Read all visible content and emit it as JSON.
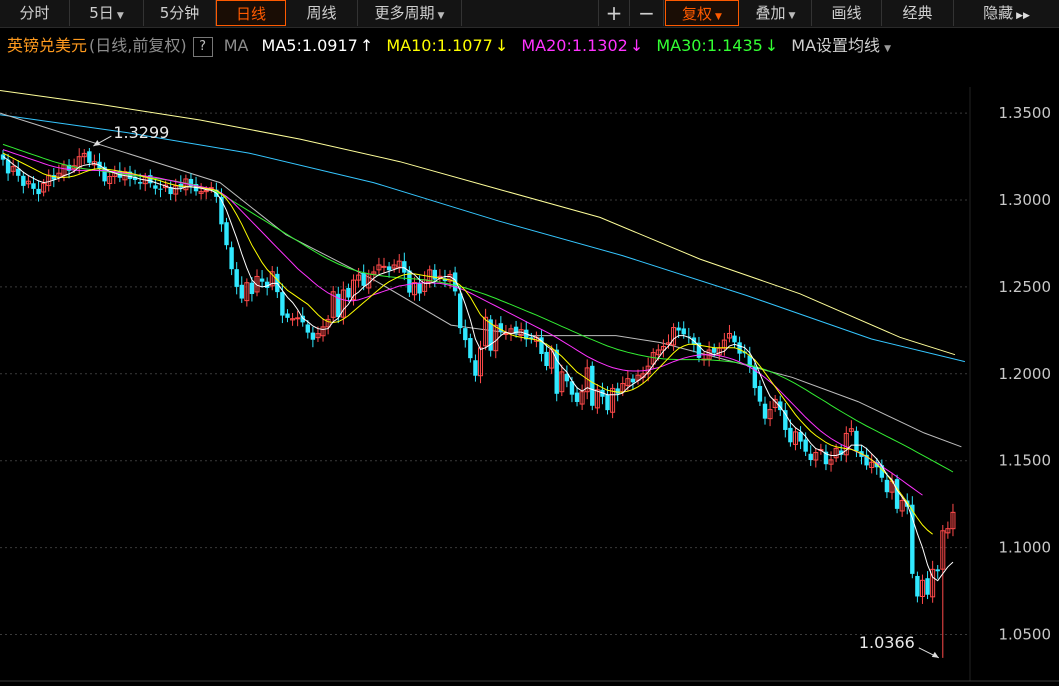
{
  "toolbar": {
    "tabs": [
      {
        "label": "分时",
        "arrow": ""
      },
      {
        "label": "5日",
        "arrow": "▼"
      },
      {
        "label": "5分钟",
        "arrow": ""
      },
      {
        "label": "日线",
        "arrow": ""
      },
      {
        "label": "周线",
        "arrow": ""
      },
      {
        "label": "更多周期",
        "arrow": "▼"
      }
    ],
    "active_tab": "日线",
    "zoom_in": "+",
    "zoom_out": "−",
    "right": [
      {
        "label": "复权",
        "arrow": "▼",
        "active": true
      },
      {
        "label": "叠加",
        "arrow": "▼",
        "active": false
      },
      {
        "label": "画线",
        "arrow": "",
        "active": false
      },
      {
        "label": "经典",
        "arrow": "",
        "active": false
      },
      {
        "label": "隐藏",
        "arrow": "▶▶",
        "active": false
      }
    ]
  },
  "legend": {
    "name": "英镑兑美元",
    "mode": "(日线,前复权)",
    "help": "?",
    "ma_label": "MA",
    "ma5": {
      "label": "MA5:1.0917",
      "arrow": "↑",
      "color": "#ffffff"
    },
    "ma10": {
      "label": "MA10:1.1077",
      "arrow": "↓",
      "color": "#ffff00"
    },
    "ma20": {
      "label": "MA20:1.1302",
      "arrow": "↓",
      "color": "#ff33ff"
    },
    "ma30": {
      "label": "MA30:1.1435",
      "arrow": "↓",
      "color": "#33ff33"
    },
    "ma_more": "MA",
    "settings": "设置均线",
    "settings_arrow": "▼"
  },
  "chart_data": {
    "type": "candlestick",
    "ylim": [
      1.025,
      1.365
    ],
    "y_ticks": [
      1.35,
      1.3,
      1.25,
      1.2,
      1.15,
      1.1,
      1.05
    ],
    "y_tick_labels": [
      "1.3500",
      "1.3000",
      "1.2500",
      "1.2000",
      "1.1500",
      "1.1000",
      "1.0500"
    ],
    "up_color": "#ff4a4a",
    "down_color": "#31e8ff",
    "annotations": [
      {
        "text": "1.3299",
        "value": 1.3299,
        "bar": 17
      },
      {
        "text": "1.0366",
        "value": 1.0366,
        "bar": 185
      }
    ],
    "closes": [
      1.3232,
      1.3153,
      1.3192,
      1.3139,
      1.3081,
      1.3108,
      1.3064,
      1.3034,
      1.3095,
      1.3143,
      1.3117,
      1.3154,
      1.3202,
      1.3168,
      1.3197,
      1.3249,
      1.3268,
      1.3214,
      1.322,
      1.3179,
      1.3107,
      1.3135,
      1.3156,
      1.3128,
      1.3163,
      1.3121,
      1.3115,
      1.3094,
      1.3131,
      1.3096,
      1.3065,
      1.3059,
      1.3086,
      1.3034,
      1.3081,
      1.3071,
      1.3121,
      1.308,
      1.305,
      1.3048,
      1.3055,
      1.3071,
      1.3018,
      1.286,
      1.274,
      1.2602,
      1.25,
      1.2433,
      1.2524,
      1.2459,
      1.256,
      1.253,
      1.2494,
      1.2587,
      1.247,
      1.2335,
      1.2322,
      1.2317,
      1.2322,
      1.2296,
      1.2237,
      1.2196,
      1.2231,
      1.227,
      1.2313,
      1.2472,
      1.2326,
      1.2482,
      1.2439,
      1.2539,
      1.2568,
      1.2506,
      1.2574,
      1.2586,
      1.2626,
      1.2618,
      1.2596,
      1.2626,
      1.2648,
      1.2582,
      1.2467,
      1.2525,
      1.2462,
      1.2541,
      1.2598,
      1.2542,
      1.2561,
      1.2533,
      1.2571,
      1.2474,
      1.2263,
      1.2194,
      1.209,
      1.1989,
      1.2149,
      1.2325,
      1.2133,
      1.2279,
      1.2242,
      1.2232,
      1.2259,
      1.2233,
      1.2254,
      1.2198,
      1.2199,
      1.221,
      1.2114,
      1.2045,
      1.2139,
      1.1885,
      1.2011,
      1.1957,
      1.188,
      1.1838,
      1.1897,
      1.2034,
      1.1816,
      1.1908,
      1.1868,
      1.1791,
      1.1916,
      1.1885,
      1.1944,
      1.1972,
      1.1951,
      1.1992,
      1.2,
      1.2044,
      1.2122,
      1.2137,
      1.2157,
      1.2178,
      1.2266,
      1.2249,
      1.2227,
      1.2209,
      1.2167,
      1.2092,
      1.2085,
      1.2137,
      1.2121,
      1.2147,
      1.2194,
      1.2232,
      1.2181,
      1.2116,
      1.2118,
      1.2039,
      1.1918,
      1.184,
      1.1742,
      1.1794,
      1.1853,
      1.1791,
      1.1677,
      1.1606,
      1.1666,
      1.161,
      1.1552,
      1.1504,
      1.1547,
      1.1564,
      1.148,
      1.1505,
      1.1571,
      1.1534,
      1.1657,
      1.1684,
      1.1555,
      1.1522,
      1.1473,
      1.1491,
      1.1462,
      1.1402,
      1.1319,
      1.1382,
      1.1223,
      1.1271,
      1.1235,
      1.0849,
      1.0719,
      1.0812,
      1.0729,
      1.0875,
      1.0864,
      1.1097,
      1.1109,
      1.1203
    ],
    "ma5": [
      1.325,
      1.323,
      1.3205,
      1.3185,
      1.316,
      1.314,
      1.3125,
      1.311,
      1.31,
      1.3105,
      1.3115,
      1.3125,
      1.314,
      1.315,
      1.3165,
      1.319,
      1.32,
      1.3205,
      1.321,
      1.32,
      1.318,
      1.3165,
      1.3155,
      1.3145,
      1.314,
      1.3135,
      1.313,
      1.312,
      1.3115,
      1.311,
      1.31,
      1.309,
      1.308,
      1.307,
      1.3065,
      1.3065,
      1.3075,
      1.3075,
      1.3072,
      1.3068,
      1.306,
      1.3055,
      1.304,
      1.3,
      1.294,
      1.286,
      1.278,
      1.269,
      1.261,
      1.254,
      1.251,
      1.25,
      1.2505,
      1.252,
      1.252,
      1.248,
      1.244,
      1.241,
      1.237,
      1.232,
      1.23,
      1.2275,
      1.226,
      1.2255,
      1.226,
      1.23,
      1.232,
      1.237,
      1.24,
      1.245,
      1.247,
      1.25,
      1.252,
      1.255,
      1.257,
      1.258,
      1.259,
      1.26,
      1.261,
      1.261,
      1.259,
      1.257,
      1.254,
      1.252,
      1.252,
      1.253,
      1.255,
      1.256,
      1.256,
      1.254,
      1.248,
      1.24,
      1.231,
      1.22,
      1.214,
      1.215,
      1.217,
      1.219,
      1.222,
      1.224,
      1.223,
      1.224,
      1.224,
      1.223,
      1.222,
      1.221,
      1.219,
      1.216,
      1.214,
      1.208,
      1.204,
      1.201,
      1.196,
      1.192,
      1.19,
      1.192,
      1.191,
      1.19,
      1.189,
      1.188,
      1.188,
      1.188,
      1.189,
      1.192,
      1.194,
      1.196,
      1.198,
      1.201,
      1.205,
      1.209,
      1.213,
      1.216,
      1.22,
      1.222,
      1.222,
      1.221,
      1.219,
      1.216,
      1.213,
      1.212,
      1.211,
      1.212,
      1.213,
      1.216,
      1.217,
      1.216,
      1.215,
      1.212,
      1.207,
      1.2,
      1.193,
      1.187,
      1.184,
      1.181,
      1.177,
      1.172,
      1.169,
      1.167,
      1.164,
      1.16,
      1.157,
      1.156,
      1.154,
      1.153,
      1.153,
      1.154,
      1.156,
      1.159,
      1.159,
      1.159,
      1.157,
      1.154,
      1.151,
      1.147,
      1.142,
      1.139,
      1.133,
      1.129,
      1.125,
      1.117,
      1.108,
      1.1,
      1.09,
      1.083,
      1.081,
      1.085,
      1.089,
      1.0917
    ],
    "ma10": [
      1.327,
      1.3255,
      1.324,
      1.3225,
      1.321,
      1.3195,
      1.318,
      1.3165,
      1.315,
      1.314,
      1.3135,
      1.313,
      1.313,
      1.3132,
      1.3138,
      1.3148,
      1.316,
      1.317,
      1.3178,
      1.318,
      1.3178,
      1.3175,
      1.317,
      1.3165,
      1.316,
      1.3155,
      1.3148,
      1.314,
      1.3132,
      1.3125,
      1.3118,
      1.311,
      1.31,
      1.3092,
      1.3085,
      1.308,
      1.3078,
      1.3076,
      1.3074,
      1.307,
      1.3066,
      1.3062,
      1.3055,
      1.3035,
      1.3005,
      1.2965,
      1.2915,
      1.286,
      1.28,
      1.274,
      1.269,
      1.264,
      1.26,
      1.257,
      1.254,
      1.251,
      1.248,
      1.246,
      1.244,
      1.242,
      1.24,
      1.237,
      1.234,
      1.2315,
      1.23,
      1.2295,
      1.23,
      1.2315,
      1.2335,
      1.236,
      1.2385,
      1.241,
      1.2435,
      1.246,
      1.2485,
      1.251,
      1.253,
      1.2545,
      1.256,
      1.257,
      1.2575,
      1.2575,
      1.257,
      1.2565,
      1.256,
      1.2555,
      1.255,
      1.2545,
      1.254,
      1.253,
      1.251,
      1.248,
      1.244,
      1.239,
      1.234,
      1.231,
      1.229,
      1.227,
      1.2255,
      1.224,
      1.2225,
      1.2215,
      1.221,
      1.2205,
      1.22,
      1.2195,
      1.2185,
      1.217,
      1.215,
      1.2125,
      1.21,
      1.207,
      1.204,
      1.201,
      1.199,
      1.197,
      1.195,
      1.1935,
      1.192,
      1.1905,
      1.19,
      1.1895,
      1.1895,
      1.19,
      1.191,
      1.1925,
      1.1945,
      1.197,
      1.2,
      1.203,
      1.206,
      1.209,
      1.212,
      1.2145,
      1.216,
      1.217,
      1.217,
      1.2165,
      1.216,
      1.2155,
      1.215,
      1.215,
      1.215,
      1.215,
      1.215,
      1.214,
      1.2125,
      1.2105,
      1.208,
      1.2045,
      1.2005,
      1.1965,
      1.1925,
      1.1885,
      1.1845,
      1.1805,
      1.1765,
      1.173,
      1.17,
      1.167,
      1.1645,
      1.1625,
      1.1605,
      1.159,
      1.158,
      1.1575,
      1.157,
      1.1565,
      1.1555,
      1.154,
      1.1525,
      1.1505,
      1.148,
      1.145,
      1.142,
      1.138,
      1.134,
      1.13,
      1.126,
      1.1215,
      1.117,
      1.113,
      1.11,
      1.1077
    ],
    "ma20": [
      1.329,
      1.328,
      1.327,
      1.326,
      1.325,
      1.324,
      1.323,
      1.322,
      1.321,
      1.32,
      1.3192,
      1.3185,
      1.318,
      1.3176,
      1.3172,
      1.317,
      1.317,
      1.317,
      1.317,
      1.317,
      1.3168,
      1.3165,
      1.3162,
      1.3158,
      1.3154,
      1.315,
      1.3146,
      1.3142,
      1.3138,
      1.3134,
      1.313,
      1.3124,
      1.3118,
      1.3112,
      1.3106,
      1.31,
      1.3094,
      1.3088,
      1.3082,
      1.3076,
      1.307,
      1.3064,
      1.3055,
      1.304,
      1.302,
      1.2995,
      1.2965,
      1.2935,
      1.2905,
      1.2875,
      1.2845,
      1.2815,
      1.2785,
      1.2755,
      1.2725,
      1.2695,
      1.2665,
      1.2635,
      1.2605,
      1.258,
      1.2555,
      1.253,
      1.2505,
      1.2485,
      1.2465,
      1.245,
      1.2435,
      1.2425,
      1.242,
      1.242,
      1.2425,
      1.2435,
      1.2445,
      1.2455,
      1.2465,
      1.2475,
      1.2485,
      1.2495,
      1.2505,
      1.251,
      1.2515,
      1.252,
      1.2522,
      1.2523,
      1.2523,
      1.2522,
      1.252,
      1.2515,
      1.2508,
      1.25,
      1.249,
      1.2478,
      1.2465,
      1.245,
      1.2435,
      1.242,
      1.2405,
      1.239,
      1.2375,
      1.236,
      1.2345,
      1.233,
      1.2315,
      1.23,
      1.2285,
      1.227,
      1.2255,
      1.224,
      1.2225,
      1.2208,
      1.219,
      1.2172,
      1.2154,
      1.2136,
      1.2118,
      1.21,
      1.2085,
      1.207,
      1.2058,
      1.2046,
      1.2036,
      1.2028,
      1.2022,
      1.2018,
      1.2016,
      1.2016,
      1.2018,
      1.2022,
      1.2028,
      1.2036,
      1.2046,
      1.2058,
      1.207,
      1.208,
      1.209,
      1.2098,
      1.2104,
      1.2108,
      1.211,
      1.211,
      1.2108,
      1.2104,
      1.2098,
      1.209,
      1.208,
      1.2068,
      1.2054,
      1.2038,
      1.202,
      1.2,
      1.1978,
      1.1954,
      1.1928,
      1.19,
      1.187,
      1.184,
      1.181,
      1.178,
      1.175,
      1.1722,
      1.1695,
      1.167,
      1.1648,
      1.1628,
      1.161,
      1.1594,
      1.158,
      1.1566,
      1.1552,
      1.1538,
      1.1522,
      1.1505,
      1.1487,
      1.1468,
      1.1448,
      1.1428,
      1.1407,
      1.1386,
      1.1365,
      1.1344,
      1.1323,
      1.1302
    ],
    "ma30": [
      1.332,
      1.331,
      1.33,
      1.329,
      1.328,
      1.327,
      1.326,
      1.325,
      1.324,
      1.323,
      1.322,
      1.3212,
      1.3204,
      1.3196,
      1.319,
      1.3184,
      1.318,
      1.3176,
      1.3172,
      1.3168,
      1.3164,
      1.316,
      1.3156,
      1.3152,
      1.3148,
      1.3144,
      1.314,
      1.3136,
      1.3132,
      1.3128,
      1.3124,
      1.312,
      1.3116,
      1.3112,
      1.3108,
      1.3102,
      1.3096,
      1.309,
      1.3084,
      1.3076,
      1.3068,
      1.3058,
      1.3046,
      1.3032,
      1.3016,
      1.2998,
      1.298,
      1.2962,
      1.2944,
      1.2926,
      1.2908,
      1.289,
      1.2872,
      1.2854,
      1.2836,
      1.2818,
      1.28,
      1.2782,
      1.2764,
      1.2746,
      1.2728,
      1.271,
      1.2692,
      1.2676,
      1.266,
      1.2646,
      1.2632,
      1.262,
      1.2608,
      1.2598,
      1.259,
      1.2582,
      1.2575,
      1.257,
      1.2566,
      1.2562,
      1.2558,
      1.2555,
      1.2552,
      1.255,
      1.2548,
      1.2546,
      1.2543,
      1.254,
      1.2536,
      1.2532,
      1.2527,
      1.2522,
      1.2516,
      1.251,
      1.2502,
      1.2494,
      1.2485,
      1.2476,
      1.2466,
      1.2456,
      1.2445,
      1.2434,
      1.2422,
      1.241,
      1.2398,
      1.2386,
      1.2374,
      1.2362,
      1.235,
      1.2338,
      1.2325,
      1.2312,
      1.2299,
      1.2286,
      1.2273,
      1.226,
      1.2247,
      1.2234,
      1.2221,
      1.2208,
      1.2196,
      1.2184,
      1.2172,
      1.216,
      1.215,
      1.214,
      1.2132,
      1.2124,
      1.2117,
      1.211,
      1.2104,
      1.2098,
      1.2093,
      1.2089,
      1.2086,
      1.2084,
      1.2083,
      1.2082,
      1.2082,
      1.2082,
      1.2082,
      1.2082,
      1.2081,
      1.208,
      1.2078,
      1.2076,
      1.2073,
      1.207,
      1.2066,
      1.2062,
      1.2056,
      1.205,
      1.2042,
      1.2034,
      1.2024,
      1.2013,
      1.2001,
      1.1988,
      1.1974,
      1.1959,
      1.1943,
      1.1926,
      1.1909,
      1.1891,
      1.1873,
      1.1855,
      1.1837,
      1.1819,
      1.1801,
      1.1783,
      1.1766,
      1.1749,
      1.1732,
      1.1716,
      1.17,
      1.1685,
      1.167,
      1.1655,
      1.164,
      1.1625,
      1.161,
      1.1595,
      1.158,
      1.1564,
      1.1548,
      1.1532,
      1.1516,
      1.15,
      1.1484,
      1.1468,
      1.1452,
      1.1435
    ],
    "ma_white_long": [
      [
        0,
        1.35
      ],
      [
        20,
        1.342
      ],
      [
        50,
        1.33
      ],
      [
        100,
        1.31
      ],
      [
        130,
        1.28
      ],
      [
        170,
        1.254
      ],
      [
        205,
        1.228
      ],
      [
        240,
        1.222
      ],
      [
        280,
        1.222
      ],
      [
        300,
        1.218
      ],
      [
        330,
        1.208
      ],
      [
        360,
        1.198
      ],
      [
        390,
        1.184
      ],
      [
        420,
        1.166
      ],
      [
        437,
        1.158
      ]
    ],
    "ma_cyan": [
      [
        0,
        1.349
      ],
      [
        100,
        1.339
      ],
      [
        200,
        1.327
      ],
      [
        300,
        1.31
      ],
      [
        400,
        1.288
      ],
      [
        500,
        1.268
      ],
      [
        600,
        1.245
      ],
      [
        700,
        1.22
      ],
      [
        775,
        1.207
      ]
    ],
    "ma_yellow_long": [
      [
        0,
        1.363
      ],
      [
        100,
        1.355
      ],
      [
        200,
        1.346
      ],
      [
        300,
        1.335
      ],
      [
        400,
        1.322
      ],
      [
        500,
        1.306
      ],
      [
        600,
        1.29
      ],
      [
        700,
        1.266
      ],
      [
        800,
        1.246
      ],
      [
        900,
        1.221
      ],
      [
        955,
        1.211
      ]
    ]
  }
}
